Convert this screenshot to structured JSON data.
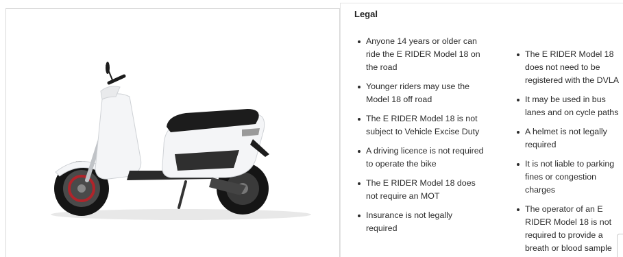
{
  "product_image": {
    "alt": "White E RIDER Model 18 electric scooter"
  },
  "legal": {
    "title": "Legal",
    "left_items": [
      "Anyone 14 years or older can ride the E RIDER Model 18 on the road",
      "Younger riders may use the Model 18 off road",
      "The E RIDER Model 18 is not subject to Vehicle Excise Duty",
      "A driving licence is not required to operate the bike",
      "The E RIDER Model 18 does not require an MOT",
      "Insurance is not legally required"
    ],
    "right_items": [
      "The E RIDER Model 18 does not need to be registered with the DVLA",
      "It may be used in bus lanes and on cycle paths",
      "A helmet is not legally required",
      "It is not liable to parking fines or congestion charges",
      "The operator of an E RIDER Model 18 is not required to provide a breath or blood sample"
    ]
  },
  "colors": {
    "scooter_body": "#f4f5f7",
    "seat": "#1c1c1c",
    "tyre": "#151515",
    "brake_accent": "#b0242a"
  }
}
